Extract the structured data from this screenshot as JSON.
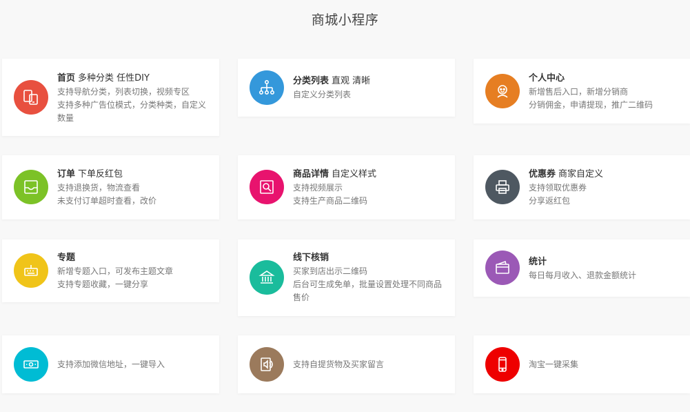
{
  "page": {
    "title": "商城小程序"
  },
  "colors": {
    "card_home": "#e8503f",
    "card_category": "#3498db",
    "card_personal": "#e67e22",
    "card_order": "#7cc227",
    "card_product": "#e8136e",
    "card_coupon": "#4e5861",
    "card_topic": "#f0c419",
    "card_offline": "#1abc9c",
    "card_stats": "#9b59b6",
    "card_address": "#00bcd4",
    "card_pickup": "#9b7a5c",
    "card_taobao": "#ee0000"
  },
  "cards": [
    {
      "icon": "devices-icon",
      "title": "首页",
      "subtitle": "多种分类 任性DIY",
      "lines": [
        "支持导航分类，列表切换，视频专区",
        "支持多种广告位模式，分类种类，自定义数量"
      ]
    },
    {
      "icon": "hierarchy-icon",
      "title": "分类列表",
      "subtitle": "直观 清晰",
      "lines": [
        "自定义分类列表"
      ]
    },
    {
      "icon": "person-icon",
      "title": "个人中心",
      "subtitle": "",
      "lines": [
        "新增售后入口，新增分销商",
        "分销佣金，申请提现，推广二维码"
      ]
    },
    {
      "icon": "tray-icon",
      "title": "订单",
      "subtitle": "下单反红包",
      "lines": [
        "支持退换货，物流查看",
        "未支付订单超时查看，改价"
      ]
    },
    {
      "icon": "magnifier-doc-icon",
      "title": "商品详情",
      "subtitle": "自定义样式",
      "lines": [
        "支持视频展示",
        "支持生产商品二维码"
      ]
    },
    {
      "icon": "printer-icon",
      "title": "优惠券",
      "subtitle": "商家自定义",
      "lines": [
        "支持领取优惠券",
        "分享返红包"
      ]
    },
    {
      "icon": "keyboard-icon",
      "title": "专题",
      "subtitle": "",
      "lines": [
        "新增专题入口，可发布主题文章",
        "支持专题收藏，一键分享"
      ]
    },
    {
      "icon": "bank-icon",
      "title": "线下核销",
      "subtitle": "",
      "lines": [
        "买家到店出示二维码",
        "后台可生成免单，批量设置处理不同商品售价"
      ]
    },
    {
      "icon": "wallet-icon",
      "title": "统计",
      "subtitle": "",
      "lines": [
        "每日每月收入、退款金额统计"
      ]
    },
    {
      "icon": "banknote-icon",
      "title": "",
      "subtitle": "",
      "lines": [
        "支持添加微信地址，一键导入"
      ]
    },
    {
      "icon": "speaker-doc-icon",
      "title": "",
      "subtitle": "",
      "lines": [
        "支持自提货物及买家留言"
      ]
    },
    {
      "icon": "phone-icon",
      "title": "",
      "subtitle": "",
      "lines": [
        "淘宝一键采集"
      ]
    }
  ]
}
